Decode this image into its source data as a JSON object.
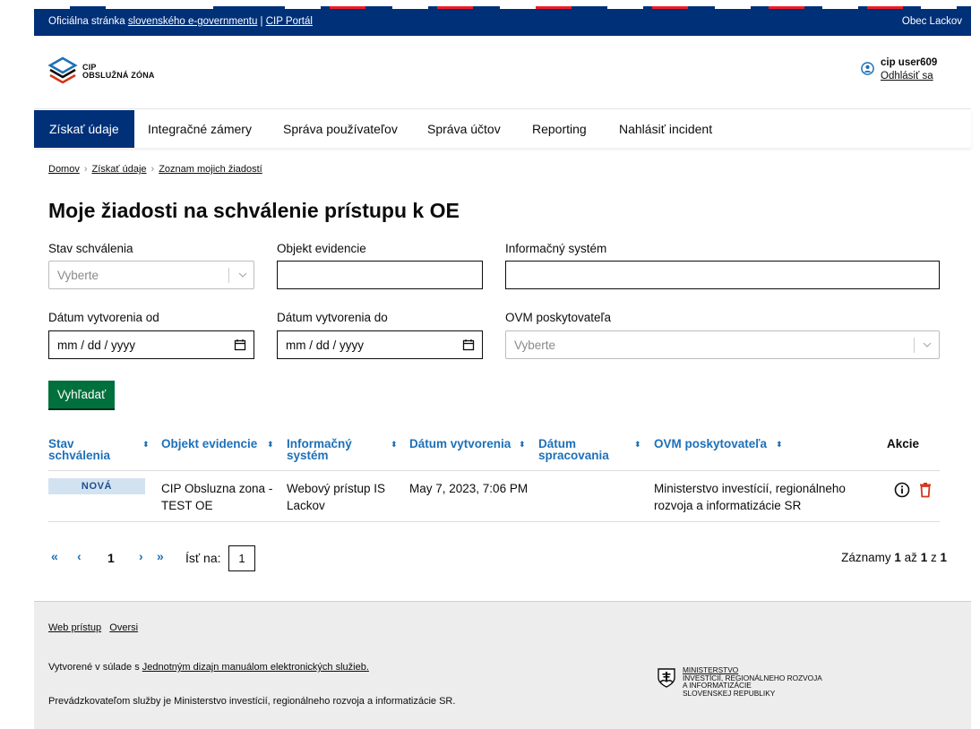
{
  "gov_bar": {
    "prefix": "Oficiálna stránka",
    "gov_link": "slovenského e-governmentu",
    "separator": "|",
    "portal_link": "CIP Portál",
    "municipality": "Obec Lackov"
  },
  "header": {
    "logo_line1": "CIP",
    "logo_line2": "OBSLUŽNÁ ZÓNA",
    "username": "cip user609",
    "logout": "Odhlásiť sa"
  },
  "nav": {
    "items": [
      {
        "label": "Získať údaje",
        "active": true
      },
      {
        "label": "Integračné zámery"
      },
      {
        "label": "Správa používateľov"
      },
      {
        "label": "Správa účtov"
      },
      {
        "label": "Reporting"
      },
      {
        "label": "Nahlásiť incident"
      }
    ]
  },
  "breadcrumb": [
    "Domov",
    "Získať údaje",
    "Zoznam mojich žiadostí"
  ],
  "title": "Moje žiadosti na schválenie prístupu k OE",
  "filters": {
    "status_label": "Stav schválenia",
    "status_placeholder": "Vyberte",
    "object_label": "Objekt evidencie",
    "object_value": "",
    "system_label": "Informačný systém",
    "system_value": "",
    "date_from_label": "Dátum vytvorenia od",
    "date_from_value": "mm / dd / yyyy",
    "date_to_label": "Dátum vytvorenia do",
    "date_to_value": "mm / dd / yyyy",
    "ovm_label": "OVM poskytovateľa",
    "ovm_placeholder": "Vyberte",
    "search_button": "Vyhľadať"
  },
  "table": {
    "headers": {
      "status": [
        "Stav",
        "schválenia"
      ],
      "object": "Objekt evidencie",
      "system": [
        "Informačný",
        "systém"
      ],
      "created": "Dátum vytvorenia",
      "processed": [
        "Dátum",
        "spracovania"
      ],
      "ovm": "OVM poskytovateľa",
      "actions": "Akcie"
    },
    "rows": [
      {
        "status": "NOVÁ",
        "object": [
          "CIP Obsluzna zona -",
          "TEST OE"
        ],
        "system": [
          "Webový prístup IS",
          "Lackov"
        ],
        "created": "May 7, 2023, 7:06 PM",
        "processed": "",
        "ovm": [
          "Ministerstvo investícií, regionálneho",
          "rozvoja a informatizácie SR"
        ]
      }
    ]
  },
  "pagination": {
    "first": "«",
    "prev": "‹",
    "current": "1",
    "next": "›",
    "last": "»",
    "goto_label": "Ísť na:",
    "goto_value": "1",
    "records_prefix": "Záznamy",
    "records_from": "1",
    "records_mid": "až",
    "records_to": "1",
    "records_of": "z",
    "records_total": "1"
  },
  "footer": {
    "links": [
      "Web prístup",
      "Oversi"
    ],
    "manual_prefix": "Vytvorené v súlade s",
    "manual_link": "Jednotným dizajn manuálom elektronických služieb.",
    "operator": "Prevádzkovateľom služby je Ministerstvo investícií, regionálneho rozvoja a informatizácie SR.",
    "ministry_lines": [
      "MINISTERSTVO",
      "INVESTÍCIÍ, REGIONÁLNEHO ROZVOJA",
      "A INFORMATIZÁCIE",
      "SLOVENSKEJ REPUBLIKY"
    ]
  },
  "colors": {
    "gov_blue": "#003078",
    "link_blue": "#1d70b8",
    "button_green": "#00703c",
    "delete_red": "#d4351c",
    "badge_bg": "#d2e2f1"
  }
}
